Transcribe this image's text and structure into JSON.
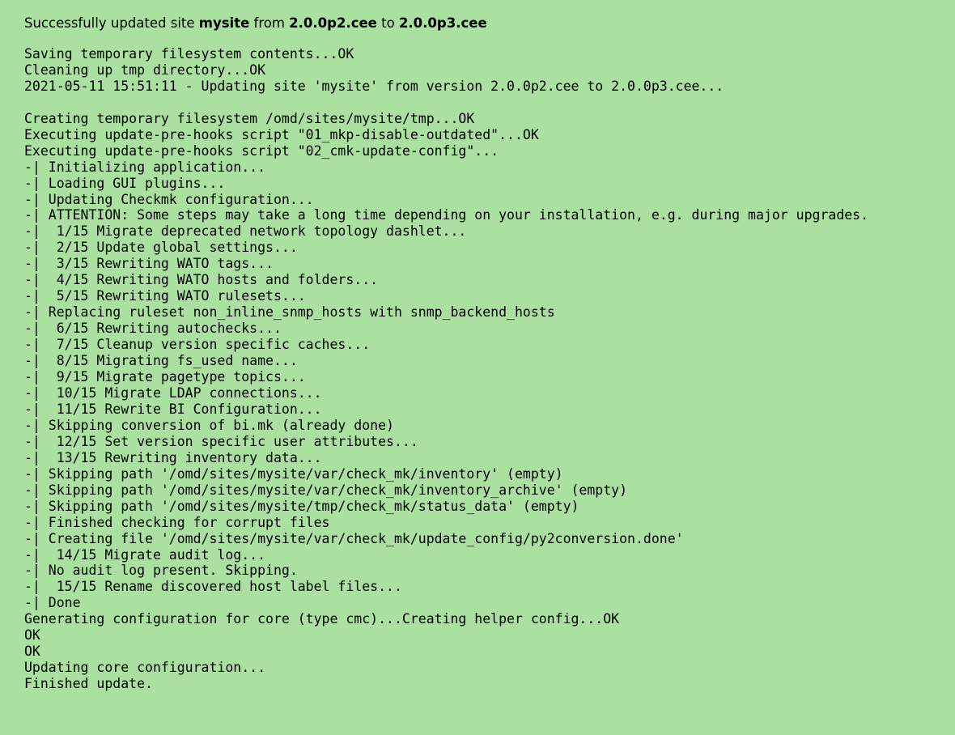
{
  "header": {
    "prefix": "Successfully updated site ",
    "site": "mysite",
    "mid": " from ",
    "from_version": "2.0.0p2.cee",
    "to_word": " to ",
    "to_version": "2.0.0p3.cee"
  },
  "log_lines": [
    "Saving temporary filesystem contents...OK",
    "Cleaning up tmp directory...OK",
    "2021-05-11 15:51:11 - Updating site 'mysite' from version 2.0.0p2.cee to 2.0.0p3.cee...",
    "",
    "Creating temporary filesystem /omd/sites/mysite/tmp...OK",
    "Executing update-pre-hooks script \"01_mkp-disable-outdated\"...OK",
    "Executing update-pre-hooks script \"02_cmk-update-config\"...",
    "-| Initializing application...",
    "-| Loading GUI plugins...",
    "-| Updating Checkmk configuration...",
    "-| ATTENTION: Some steps may take a long time depending on your installation, e.g. during major upgrades.",
    "-|  1/15 Migrate deprecated network topology dashlet...",
    "-|  2/15 Update global settings...",
    "-|  3/15 Rewriting WATO tags...",
    "-|  4/15 Rewriting WATO hosts and folders...",
    "-|  5/15 Rewriting WATO rulesets...",
    "-| Replacing ruleset non_inline_snmp_hosts with snmp_backend_hosts",
    "-|  6/15 Rewriting autochecks...",
    "-|  7/15 Cleanup version specific caches...",
    "-|  8/15 Migrating fs_used name...",
    "-|  9/15 Migrate pagetype topics...",
    "-|  10/15 Migrate LDAP connections...",
    "-|  11/15 Rewrite BI Configuration...",
    "-| Skipping conversion of bi.mk (already done)",
    "-|  12/15 Set version specific user attributes...",
    "-|  13/15 Rewriting inventory data...",
    "-| Skipping path '/omd/sites/mysite/var/check_mk/inventory' (empty)",
    "-| Skipping path '/omd/sites/mysite/var/check_mk/inventory_archive' (empty)",
    "-| Skipping path '/omd/sites/mysite/tmp/check_mk/status_data' (empty)",
    "-| Finished checking for corrupt files",
    "-| Creating file '/omd/sites/mysite/var/check_mk/update_config/py2conversion.done'",
    "-|  14/15 Migrate audit log...",
    "-| No audit log present. Skipping.",
    "-|  15/15 Rename discovered host label files...",
    "-| Done",
    "Generating configuration for core (type cmc)...Creating helper config...OK",
    "OK",
    "OK",
    "Updating core configuration...",
    "Finished update."
  ]
}
